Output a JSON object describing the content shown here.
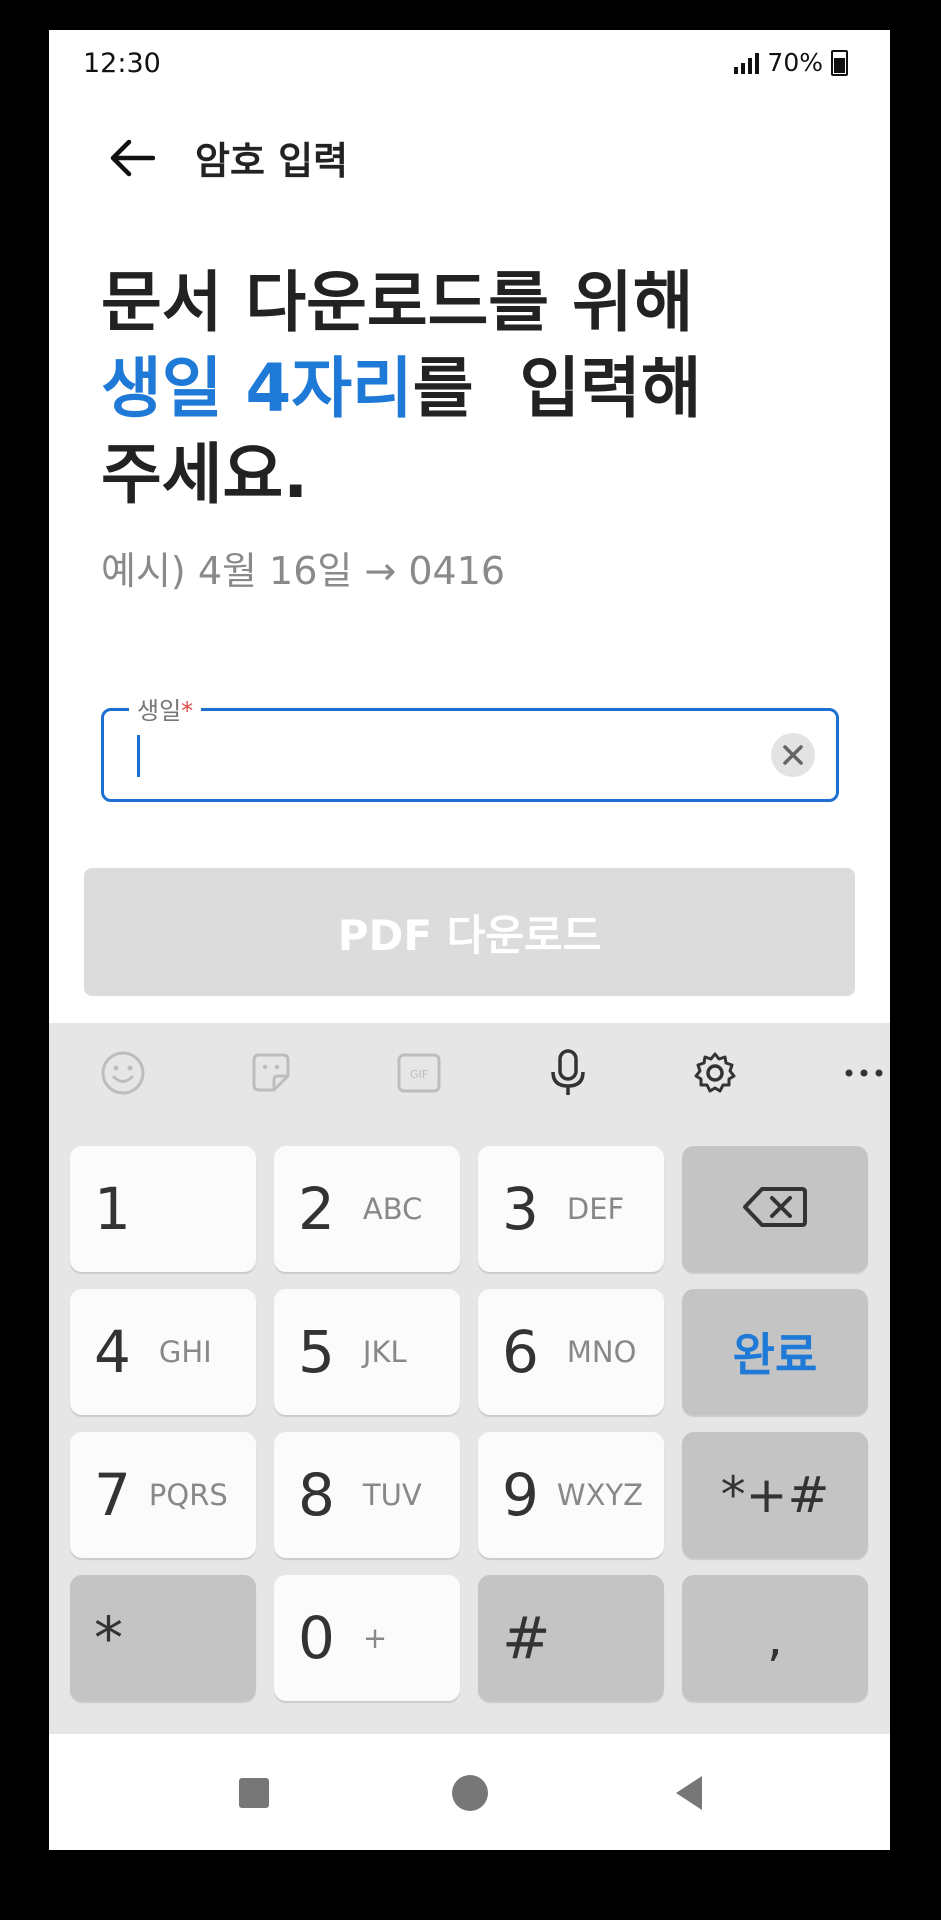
{
  "status_bar": {
    "time": "12:30",
    "battery": "70%"
  },
  "app_bar": {
    "title": "암호 입력"
  },
  "headline": {
    "line1": "문서 다운로드를 위해",
    "line2_highlight": "생일 4자리",
    "line2_rest": "를  입력해",
    "line3": "주세요."
  },
  "hint": "예시) 4월 16일 → 0416",
  "birthday_field": {
    "label": "생일",
    "required_mark": "*",
    "value": ""
  },
  "download_button": {
    "label": "PDF 다운로드",
    "enabled": false
  },
  "colors": {
    "accent": "#1e7ad6",
    "focus_border": "#1e6fd2",
    "disabled_button": "#dcdcdc",
    "required": "#e04a4a"
  },
  "keyboard": {
    "toolbar_icons": [
      "emoji-icon",
      "sticker-icon",
      "gif-icon",
      "microphone-icon",
      "gear-icon",
      "more-icon"
    ],
    "gif_label": "GIF",
    "keys": {
      "k1": {
        "num": "1",
        "letters": ""
      },
      "k2": {
        "num": "2",
        "letters": "ABC"
      },
      "k3": {
        "num": "3",
        "letters": "DEF"
      },
      "k4": {
        "num": "4",
        "letters": "GHI"
      },
      "k5": {
        "num": "5",
        "letters": "JKL"
      },
      "k6": {
        "num": "6",
        "letters": "MNO"
      },
      "k7": {
        "num": "7",
        "letters": "PQRS"
      },
      "k8": {
        "num": "8",
        "letters": "TUV"
      },
      "k9": {
        "num": "9",
        "letters": "WXYZ"
      },
      "k0": {
        "num": "0",
        "letters": "+"
      },
      "done": "완료",
      "symbols": "*+#",
      "star": "*",
      "hash": "#",
      "comma": ","
    }
  },
  "nav_bar": {
    "icons": [
      "recents-icon",
      "home-icon",
      "back-icon"
    ]
  }
}
